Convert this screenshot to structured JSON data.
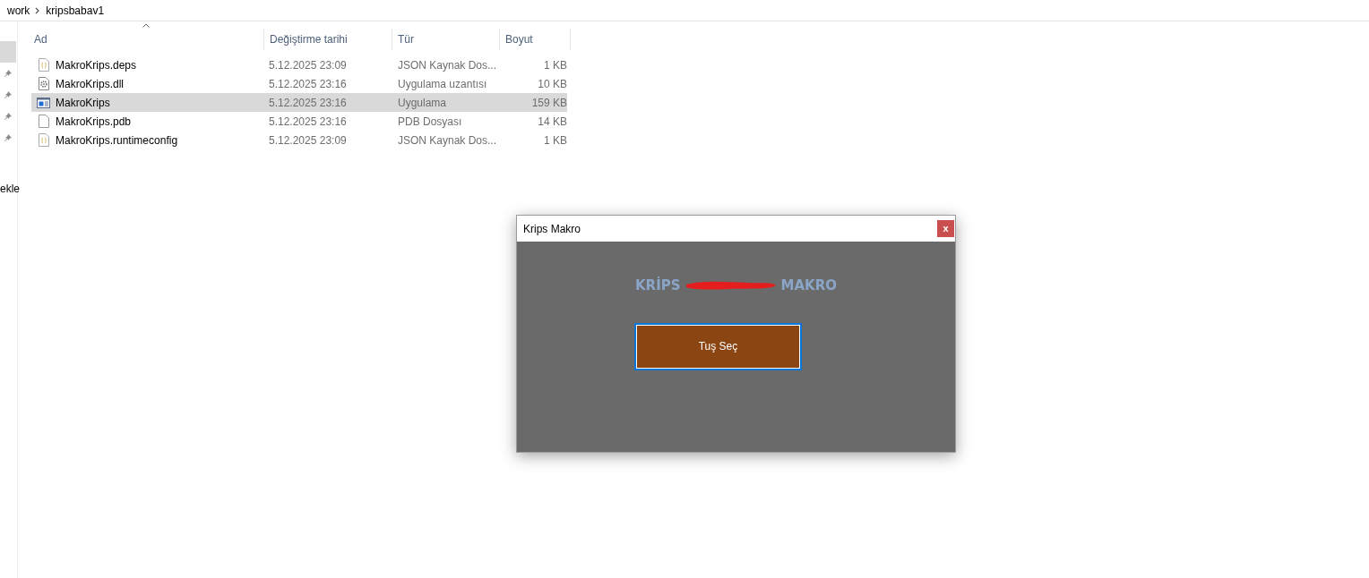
{
  "breadcrumb": [
    "work",
    "kripsbabav1"
  ],
  "nav_pane": {
    "pinned_count_items": [
      {
        "selected": true
      },
      {
        "selected": false
      },
      {
        "selected": false
      },
      {
        "selected": false
      },
      {
        "selected": false
      }
    ],
    "label": "ekle"
  },
  "file_list": {
    "columns": [
      "Ad",
      "Değiştirme tarihi",
      "Tür",
      "Boyut"
    ],
    "rows": [
      {
        "kind": "json",
        "name": "MakroKrips.deps",
        "modified": "5.12.2025 23:09",
        "type": "JSON Kaynak Dos...",
        "size": "1 KB",
        "selected": false
      },
      {
        "kind": "dll",
        "name": "MakroKrips.dll",
        "modified": "5.12.2025 23:16",
        "type": "Uygulama uzantısı",
        "size": "10 KB",
        "selected": false
      },
      {
        "kind": "exe",
        "name": "MakroKrips",
        "modified": "5.12.2025 23:16",
        "type": "Uygulama",
        "size": "159 KB",
        "selected": true
      },
      {
        "kind": "file",
        "name": "MakroKrips.pdb",
        "modified": "5.12.2025 23:16",
        "type": "PDB Dosyası",
        "size": "14 KB",
        "selected": false
      },
      {
        "kind": "json",
        "name": "MakroKrips.runtimeconfig",
        "modified": "5.12.2025 23:09",
        "type": "JSON Kaynak Dos...",
        "size": "1 KB",
        "selected": false
      }
    ]
  },
  "dialog": {
    "title": "Krips Makro",
    "close": "x",
    "heading_left": "KRİPS",
    "heading_right": "MAKRO",
    "button": "Tuş Seç"
  }
}
